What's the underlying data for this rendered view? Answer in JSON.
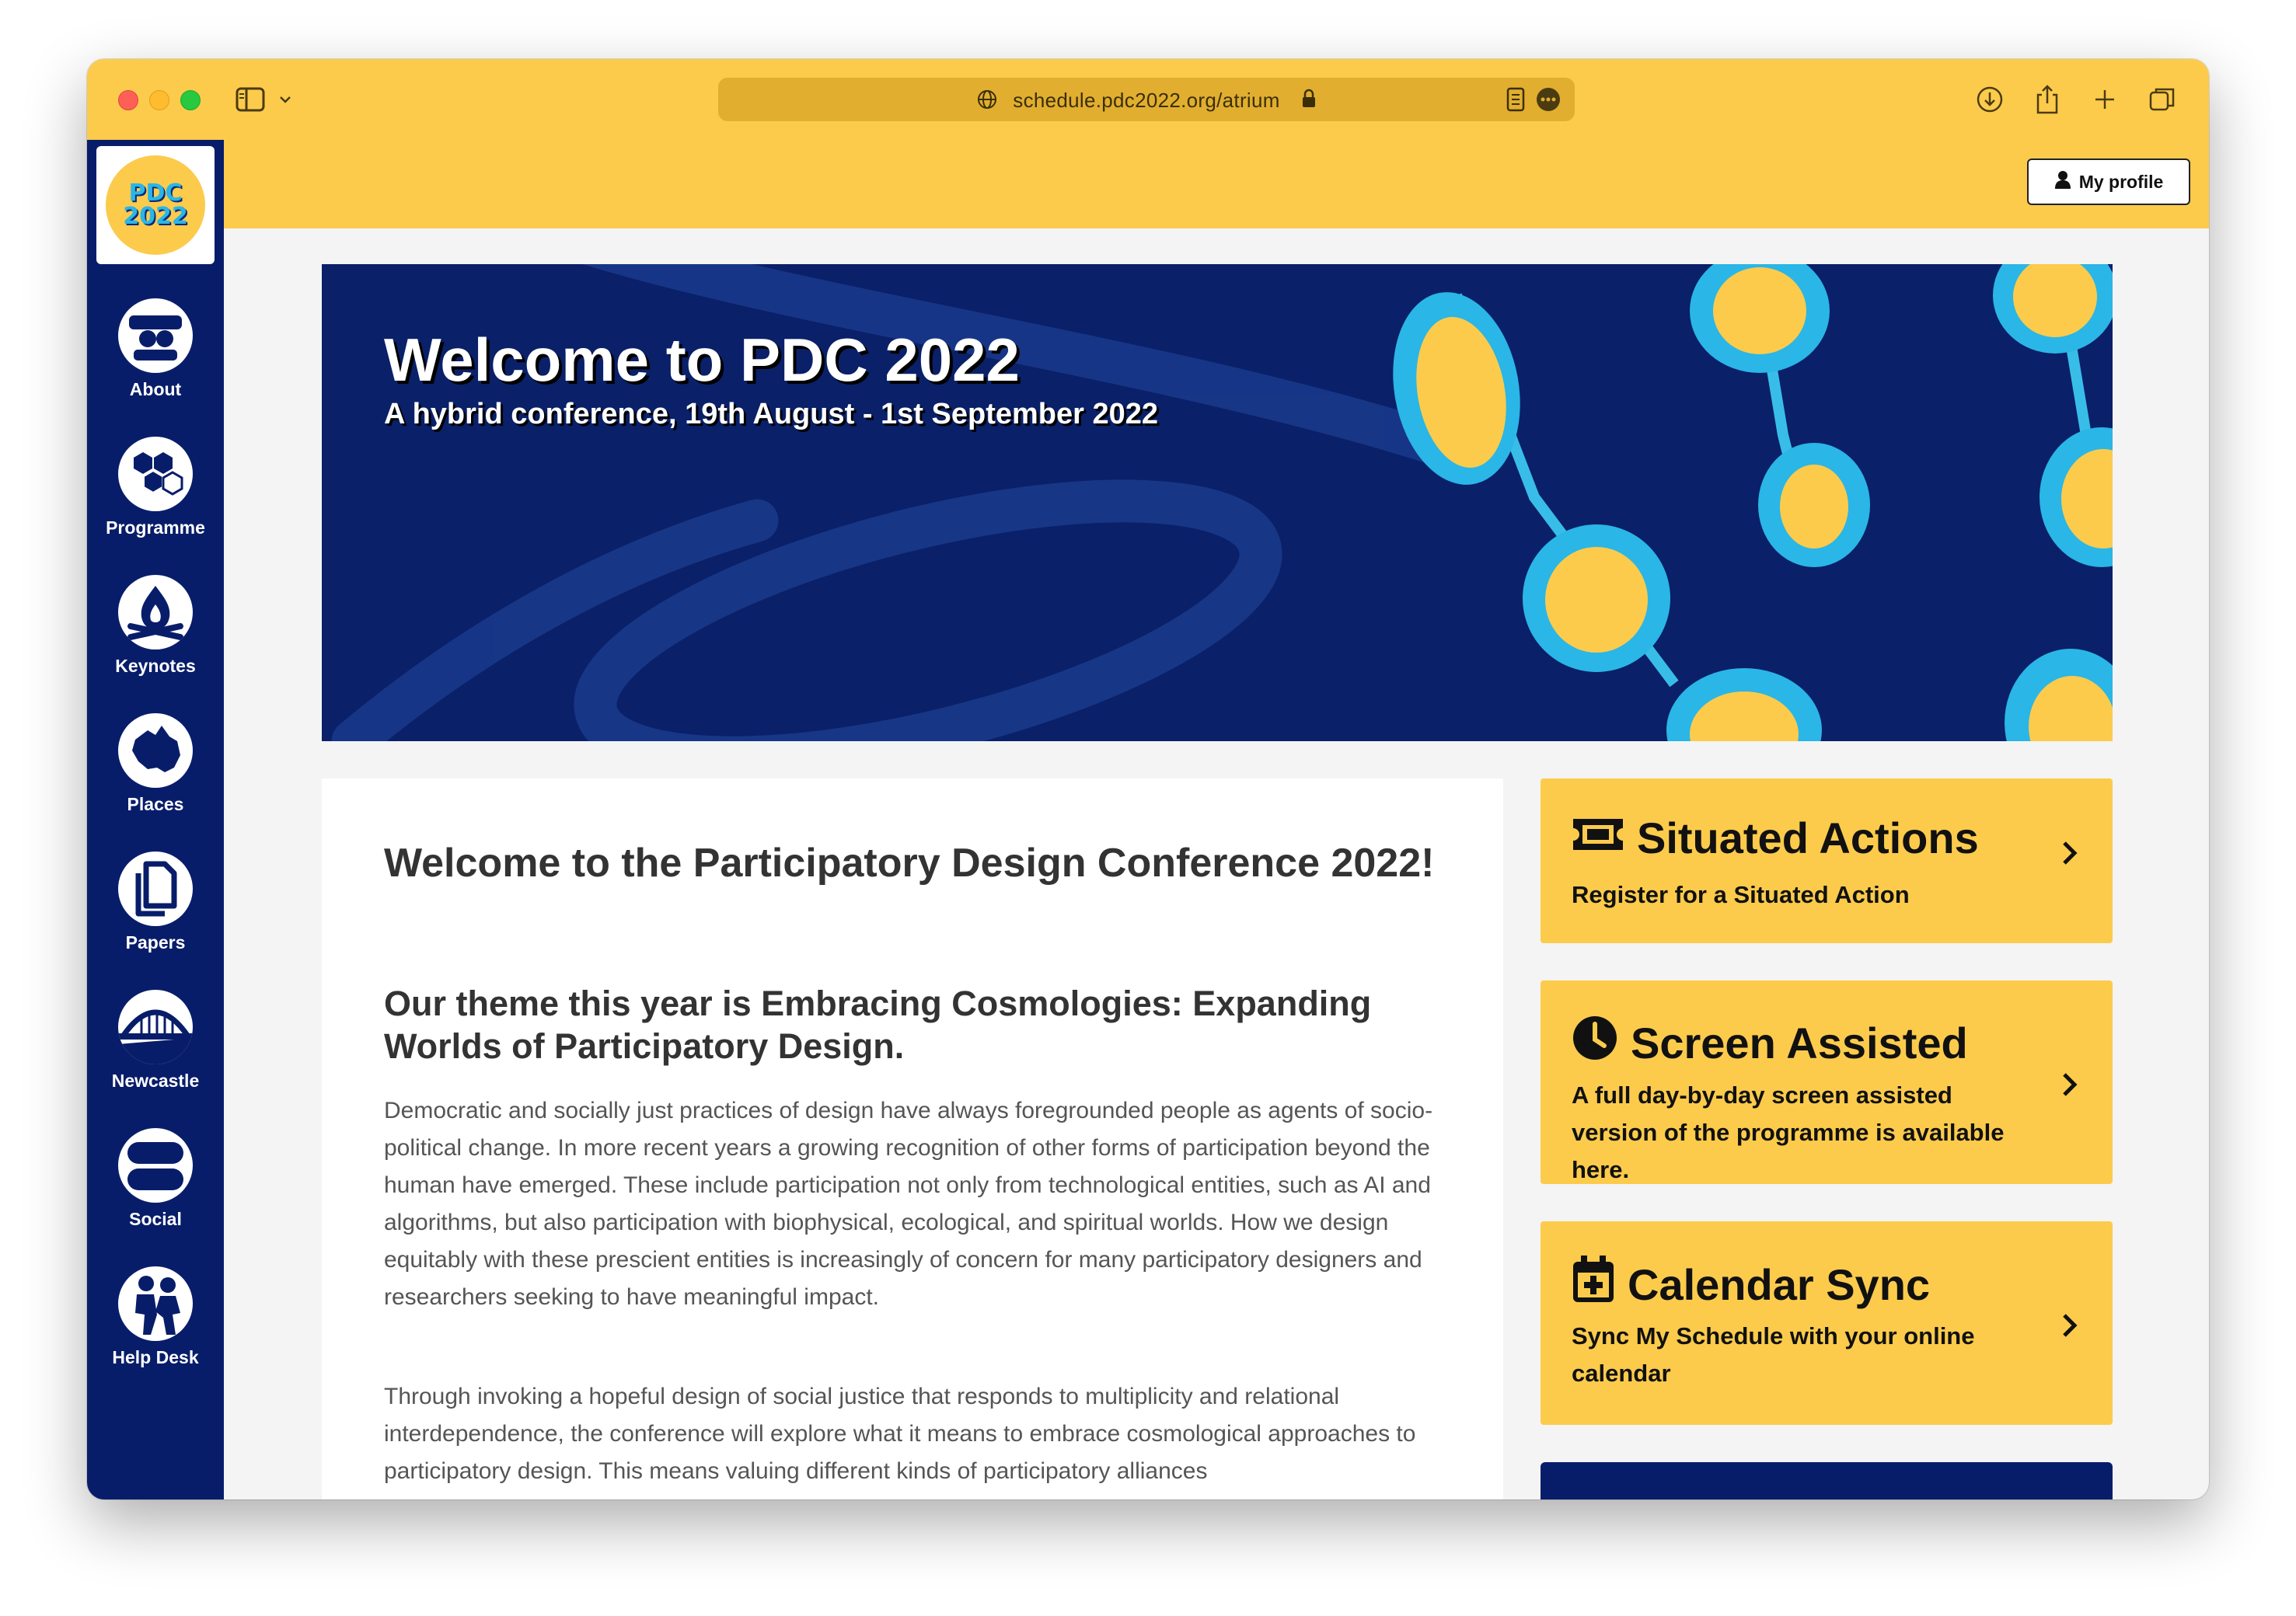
{
  "browser": {
    "url": "schedule.pdc2022.org/atrium",
    "profile_button": "My profile"
  },
  "logo": {
    "line1": "PDC",
    "line2": "2022"
  },
  "sidebar": {
    "items": [
      {
        "label": "About",
        "icon": "about-icon"
      },
      {
        "label": "Programme",
        "icon": "programme-icon"
      },
      {
        "label": "Keynotes",
        "icon": "keynotes-icon"
      },
      {
        "label": "Places",
        "icon": "places-icon"
      },
      {
        "label": "Papers",
        "icon": "papers-icon"
      },
      {
        "label": "Newcastle",
        "icon": "newcastle-icon"
      },
      {
        "label": "Social",
        "icon": "social-icon"
      },
      {
        "label": "Help Desk",
        "icon": "help-desk-icon"
      }
    ]
  },
  "banner": {
    "title": "Welcome to PDC 2022",
    "subtitle": "A hybrid conference, 19th August - 1st September 2022"
  },
  "main": {
    "heading": "Welcome to the Participatory Design Conference 2022!",
    "subheading": "Our theme this year is Embracing Cosmologies: Expanding Worlds of Participatory Design.",
    "paragraph1": "Democratic and socially just practices of design have always foregrounded people as agents of socio-political change. In more recent years a growing recognition of other forms of participation beyond the human have emerged. These include participation not only from technological entities, such as AI and algorithms, but also participation with biophysical, ecological, and spiritual worlds. How we design equitably with these prescient entities is increasingly of concern for many participatory designers and researchers seeking to have meaningful impact.",
    "paragraph2": "Through invoking a hopeful design of social justice that responds to multiplicity and relational interdependence, the conference will explore what it means to embrace cosmological approaches to participatory design. This means valuing different kinds of participatory alliances"
  },
  "cards": [
    {
      "title": "Situated Actions",
      "description": "Register for a Situated Action",
      "icon": "ticket-icon"
    },
    {
      "title": "Screen Assisted",
      "description": "A full day-by-day screen assisted version of the programme is available here.",
      "icon": "clock-icon"
    },
    {
      "title": "Calendar Sync",
      "description": "Sync My Schedule with your online calendar",
      "icon": "calendar-plus-icon"
    }
  ],
  "colors": {
    "yellow": "#fccb4c",
    "navy": "#081d6a",
    "cyan": "#2ab6e6"
  }
}
